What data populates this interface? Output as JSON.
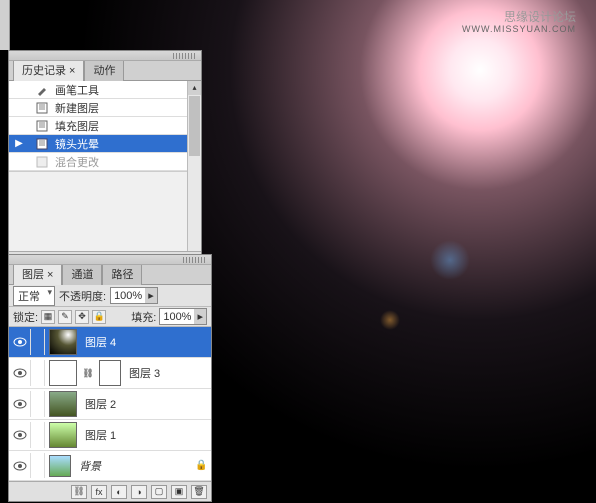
{
  "watermark": {
    "title": "思缘设计论坛",
    "url": "WWW.MISSYUAN.COM"
  },
  "history": {
    "tabs": {
      "active": "历史记录 ×",
      "inactive": "动作"
    },
    "items": [
      {
        "label": "画笔工具"
      },
      {
        "label": "新建图层"
      },
      {
        "label": "填充图层"
      },
      {
        "label": "镜头光晕"
      },
      {
        "label": "混合更改"
      }
    ]
  },
  "layers": {
    "tabs": {
      "active": "图层 ×",
      "t2": "通道",
      "t3": "路径"
    },
    "blend_mode": "正常",
    "opacity_label": "不透明度:",
    "opacity_value": "100%",
    "lock_label": "锁定:",
    "fill_label": "填充:",
    "fill_value": "100%",
    "items": [
      {
        "name": "图层 4"
      },
      {
        "name": "图层 3"
      },
      {
        "name": "图层 2"
      },
      {
        "name": "图层 1"
      },
      {
        "name": "背景"
      }
    ]
  }
}
